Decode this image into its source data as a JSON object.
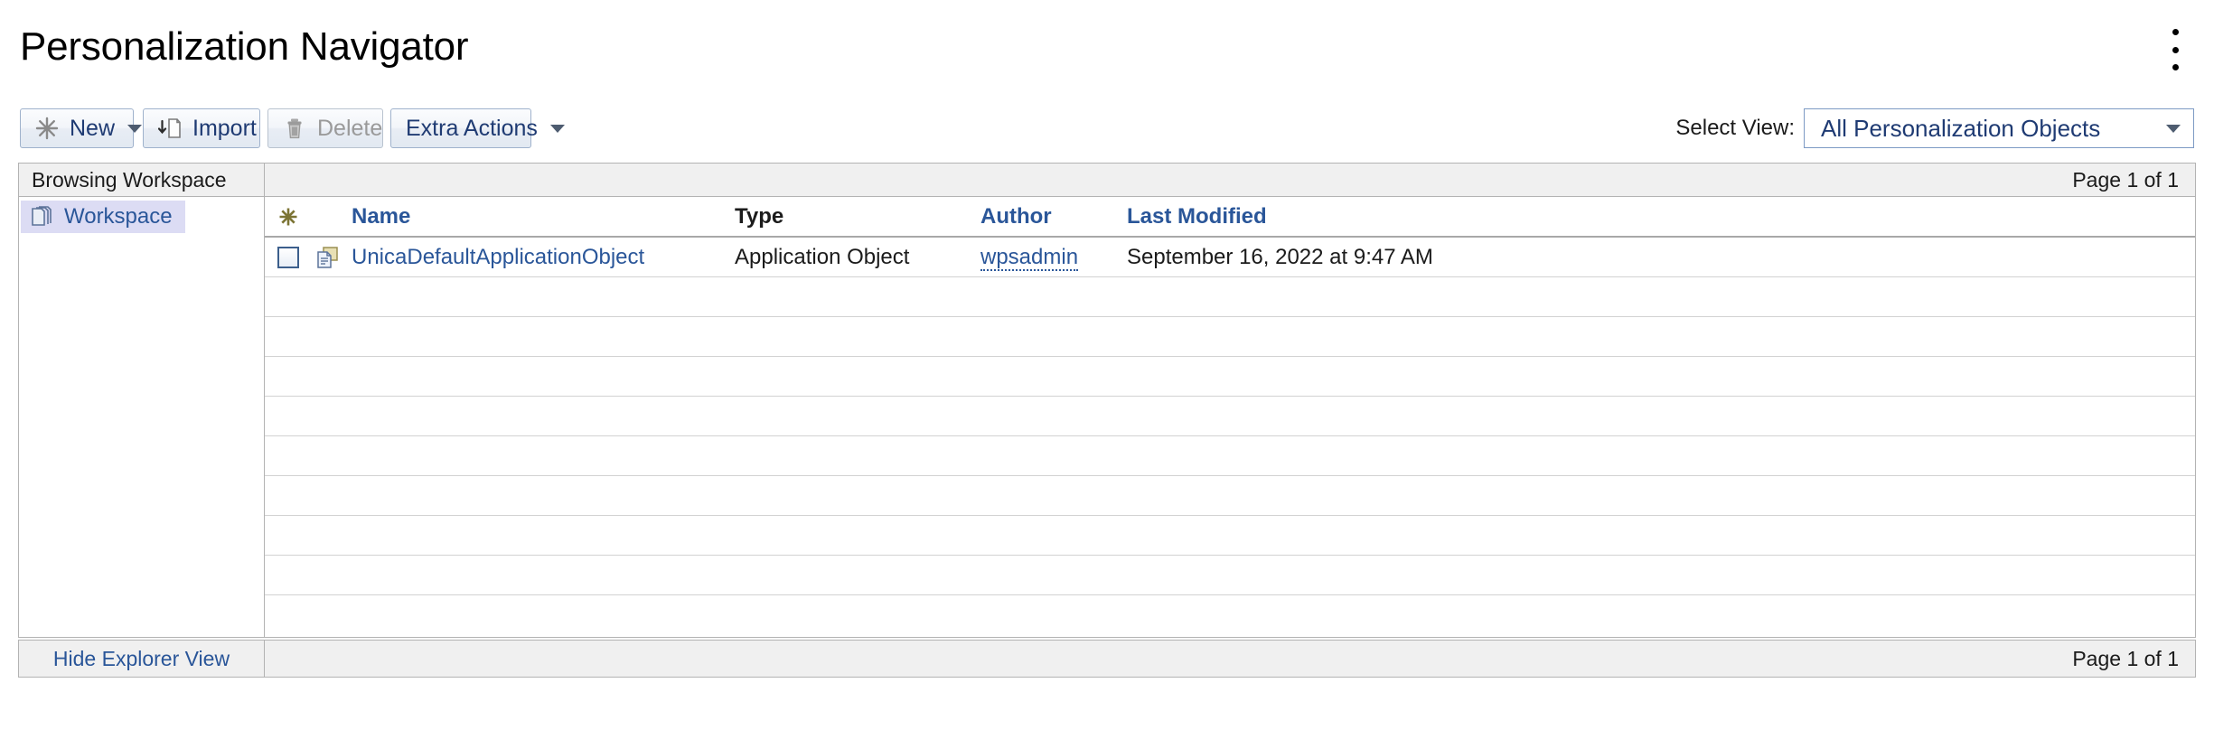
{
  "header": {
    "title": "Personalization Navigator",
    "overflow_menu_icon": "kebab-menu-icon"
  },
  "toolbar": {
    "buttons": [
      {
        "label": "New",
        "icon": "starburst-icon",
        "disabled": false,
        "has_caret": true
      },
      {
        "label": "Import",
        "icon": "import-document-icon",
        "disabled": false,
        "has_caret": false
      },
      {
        "label": "Delete",
        "icon": "trash-icon",
        "disabled": true,
        "has_caret": false
      },
      {
        "label": "Extra Actions",
        "icon": "",
        "disabled": false,
        "has_caret": true
      }
    ],
    "select_view": {
      "label": "Select View:",
      "value": "All Personalization Objects",
      "caret_icon": "chevron-down-icon"
    }
  },
  "browsing": {
    "pane_title": "Browsing Workspace",
    "page_status_top": "Page 1 of 1",
    "page_status_bottom": "Page 1 of 1",
    "hide_explorer_label": "Hide Explorer View"
  },
  "explorer": {
    "items": [
      {
        "label": "Workspace",
        "icon": "stacked-pages-icon",
        "selected": true
      }
    ]
  },
  "grid": {
    "columns": [
      {
        "key": "star",
        "label": "",
        "sortable": false,
        "style": "icon"
      },
      {
        "key": "name",
        "label": "Name",
        "sortable": true,
        "style": "link"
      },
      {
        "key": "type",
        "label": "Type",
        "sortable": false,
        "style": "plain"
      },
      {
        "key": "author",
        "label": "Author",
        "sortable": true,
        "style": "link"
      },
      {
        "key": "mod",
        "label": "Last Modified",
        "sortable": true,
        "style": "link"
      }
    ],
    "star_header_icon": "starburst-icon",
    "rows": [
      {
        "checked": false,
        "icon": "application-object-icon",
        "name": "UnicaDefaultApplicationObject",
        "type": "Application Object",
        "author": "wpsadmin",
        "last_modified": "September 16, 2022 at 9:47 AM"
      }
    ],
    "empty_row_count": 9
  },
  "colors": {
    "link": "#2a5699",
    "button_text": "#1f3b73",
    "disabled_text": "#9a9a9a",
    "selection_background": "#dcdcf4",
    "bar_background": "#f0f0f0",
    "border": "#b3b3b3",
    "star_icon": "#7c7434"
  }
}
